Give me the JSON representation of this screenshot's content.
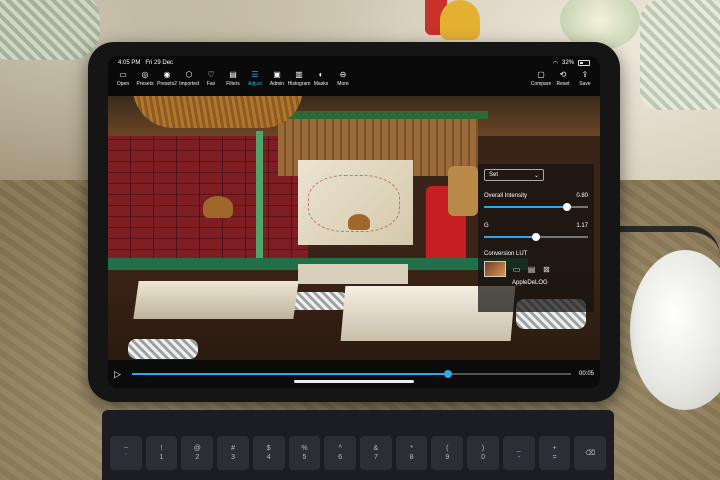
{
  "status": {
    "time": "4:05 PM",
    "date": "Fri 29 Dec",
    "battery": "32%"
  },
  "toolbar": {
    "left_items": [
      {
        "label": "Open",
        "icon": "folder-icon"
      },
      {
        "label": "Presets",
        "icon": "presets-icon"
      },
      {
        "label": "Presets2",
        "icon": "presets2-icon"
      },
      {
        "label": "Imported",
        "icon": "cube-icon"
      },
      {
        "label": "Fav",
        "icon": "heart-icon"
      },
      {
        "label": "Filters",
        "icon": "filters-icon"
      },
      {
        "label": "Adjust",
        "icon": "sliders-icon",
        "active": true
      },
      {
        "label": "Admin",
        "icon": "admin-icon"
      },
      {
        "label": "Histogram",
        "icon": "histogram-icon"
      },
      {
        "label": "Masks",
        "icon": "masks-icon"
      },
      {
        "label": "More",
        "icon": "more-icon"
      }
    ],
    "right_items": [
      {
        "label": "Compare",
        "icon": "compare-icon"
      },
      {
        "label": "Reset",
        "icon": "reset-icon"
      },
      {
        "label": "Save",
        "icon": "share-icon"
      }
    ]
  },
  "panel": {
    "select_value": "Set",
    "overall_intensity_label": "Overall Intensity",
    "overall_intensity_value": "0.80",
    "overall_intensity_fraction": 0.8,
    "gamma_label": "G",
    "gamma_value": "1.17",
    "gamma_fraction": 0.5,
    "lut_label": "Conversion LUT",
    "lut_name": "AppleDeLOG"
  },
  "playback": {
    "time": "00:05",
    "progress_fraction": 0.72
  },
  "keyboard": {
    "keys": [
      "~\n`",
      "!\n1",
      "@\n2",
      "#\n3",
      "$\n4",
      "%\n5",
      "^\n6",
      "&\n7",
      "*\n8",
      "(\n9",
      ")\n0",
      "_\n-",
      "+\n=",
      "⌫"
    ]
  },
  "colors": {
    "accent": "#2fa7e8"
  }
}
